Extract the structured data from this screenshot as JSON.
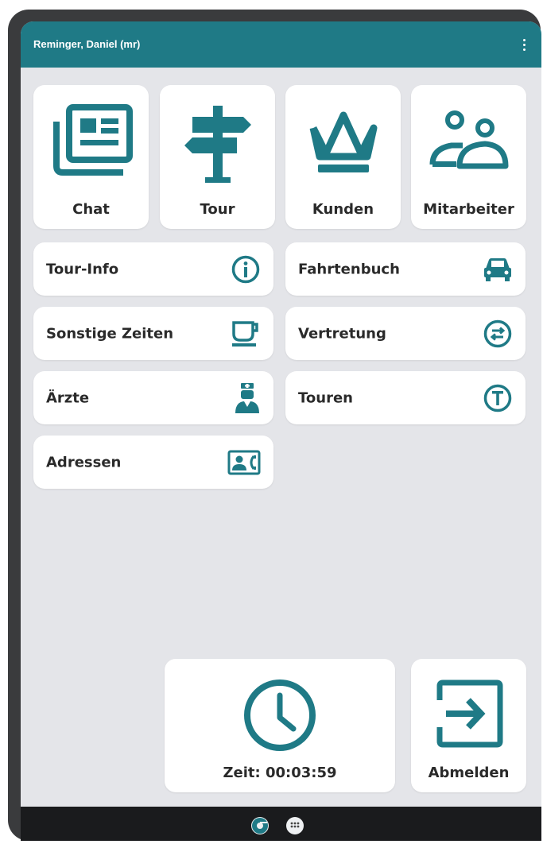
{
  "appbar": {
    "user": "Reminger, Daniel (mr)",
    "menu_icon": "more-vert-icon"
  },
  "tiles": [
    {
      "label": "Chat",
      "icon": "newspaper-icon"
    },
    {
      "label": "Tour",
      "icon": "signpost-icon"
    },
    {
      "label": "Kunden",
      "icon": "crown-icon"
    },
    {
      "label": "Mitarbeiter",
      "icon": "people-icon"
    }
  ],
  "rows": [
    {
      "label": "Tour-Info",
      "icon": "info-icon"
    },
    {
      "label": "Fahrtenbuch",
      "icon": "car-icon"
    },
    {
      "label": "Sonstige Zeiten",
      "icon": "coffee-cup-icon"
    },
    {
      "label": "Vertretung",
      "icon": "swap-icon"
    },
    {
      "label": "Ärzte",
      "icon": "doctor-icon"
    },
    {
      "label": "Touren",
      "icon": "t-circle-icon"
    },
    {
      "label": "Adressen",
      "icon": "contact-card-icon"
    }
  ],
  "bottom": {
    "time_label": "Zeit: 00:03:59",
    "logout_label": "Abmelden"
  },
  "colors": {
    "accent": "#1f7a86",
    "background": "#e4e5e9"
  }
}
